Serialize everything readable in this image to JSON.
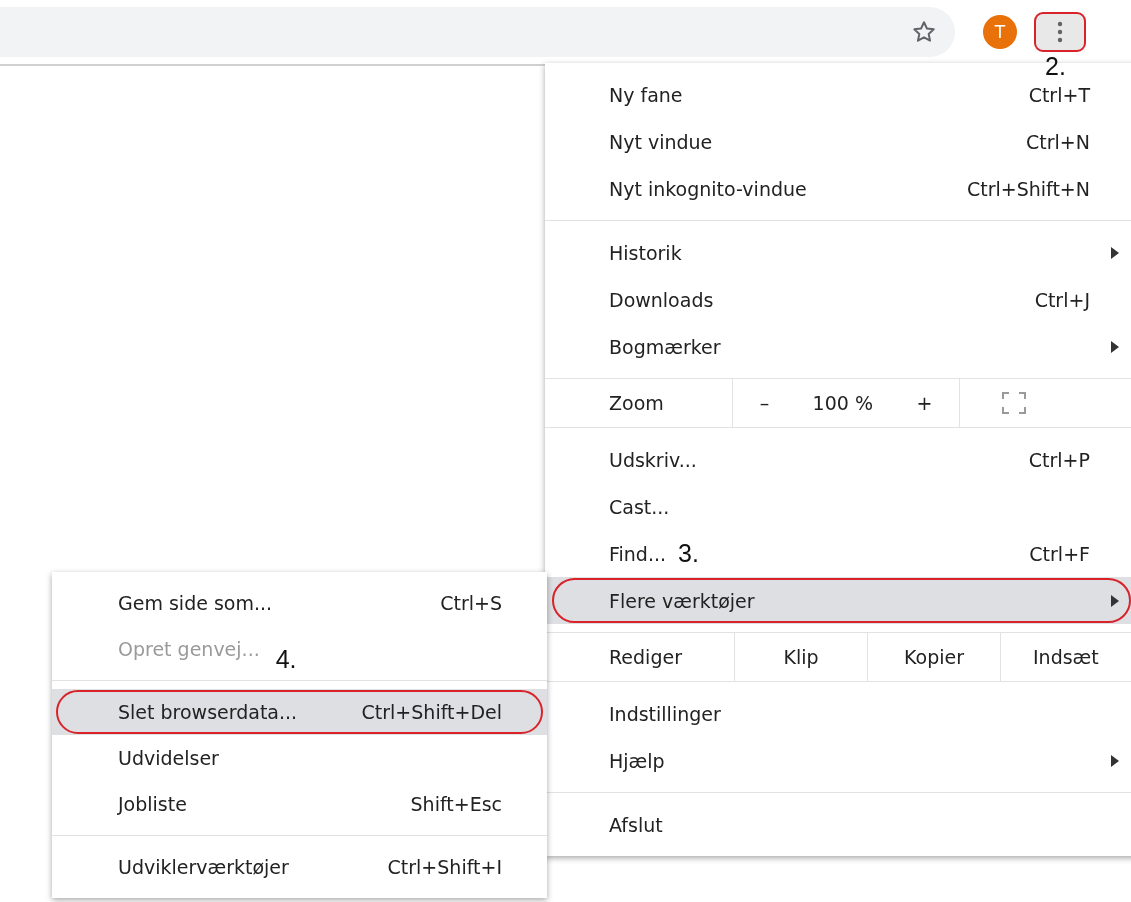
{
  "toolbar": {
    "avatar": "T",
    "menu_button_circled": true,
    "menu_button_step": "2."
  },
  "main_menu": {
    "sections": [
      {
        "kind": "items",
        "items": [
          {
            "label": "Ny fane",
            "shortcut": "Ctrl+T",
            "submenu": false,
            "selected": false,
            "circled": false
          },
          {
            "label": "Nyt vindue",
            "shortcut": "Ctrl+N",
            "submenu": false,
            "selected": false,
            "circled": false
          },
          {
            "label": "Nyt inkognito-vindue",
            "shortcut": "Ctrl+Shift+N",
            "submenu": false,
            "selected": false,
            "circled": false
          }
        ]
      },
      {
        "kind": "items",
        "items": [
          {
            "label": "Historik",
            "submenu": true,
            "selected": false,
            "circled": false
          },
          {
            "label": "Downloads",
            "shortcut": "Ctrl+J",
            "submenu": false,
            "selected": false,
            "circled": false
          },
          {
            "label": "Bogmærker",
            "submenu": true,
            "selected": false,
            "circled": false
          }
        ]
      },
      {
        "kind": "zoom",
        "label": "Zoom",
        "minus": "–",
        "value": "100 %",
        "plus": "+"
      },
      {
        "kind": "items",
        "items": [
          {
            "label": "Udskriv...",
            "shortcut": "Ctrl+P",
            "submenu": false,
            "selected": false,
            "circled": false
          },
          {
            "label": "Cast...",
            "submenu": false,
            "selected": false,
            "circled": false
          },
          {
            "label": "Find...",
            "step": "3.",
            "shortcut": "Ctrl+F",
            "submenu": false,
            "selected": false,
            "circled": false
          },
          {
            "label": "Flere værktøjer",
            "submenu": true,
            "selected": true,
            "circled": true
          }
        ]
      },
      {
        "kind": "edit",
        "label": "Rediger",
        "buttons": [
          "Klip",
          "Kopier",
          "Indsæt"
        ]
      },
      {
        "kind": "items",
        "items": [
          {
            "label": "Indstillinger",
            "submenu": false,
            "selected": false,
            "circled": false
          },
          {
            "label": "Hjælp",
            "submenu": true,
            "selected": false,
            "circled": false
          }
        ]
      },
      {
        "kind": "items",
        "items": [
          {
            "label": "Afslut",
            "submenu": false,
            "selected": false,
            "circled": false
          }
        ]
      }
    ]
  },
  "submenu": {
    "sections": [
      {
        "items": [
          {
            "label": "Gem side som...",
            "shortcut": "Ctrl+S",
            "disabled": false,
            "selected": false,
            "circled": false
          },
          {
            "label": "Opret genvej...",
            "step": "4.",
            "disabled": true,
            "selected": false,
            "circled": false
          }
        ]
      },
      {
        "items": [
          {
            "label": "Slet browserdata...",
            "shortcut": "Ctrl+Shift+Del",
            "disabled": false,
            "selected": true,
            "circled": true
          },
          {
            "label": "Udvidelser",
            "disabled": false,
            "selected": false,
            "circled": false
          },
          {
            "label": "Jobliste",
            "shortcut": "Shift+Esc",
            "disabled": false,
            "selected": false,
            "circled": false
          }
        ]
      },
      {
        "items": [
          {
            "label": "Udviklerværktøjer",
            "shortcut": "Ctrl+Shift+I",
            "disabled": false,
            "selected": false,
            "circled": false
          }
        ]
      }
    ]
  }
}
